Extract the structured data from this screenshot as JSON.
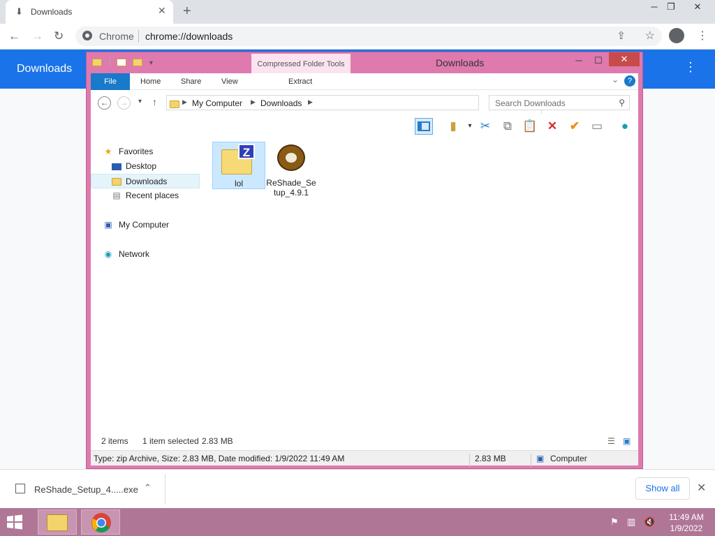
{
  "browser": {
    "tab_title": "Downloads",
    "tab_icon": "download-icon",
    "omnibox_site": "Chrome",
    "omnibox_url": "chrome://downloads"
  },
  "downloads_page": {
    "title": "Downloads"
  },
  "explorer": {
    "window_title": "Downloads",
    "context_tab": "Compressed Folder Tools",
    "ribbon_tabs": [
      "File",
      "Home",
      "Share",
      "View"
    ],
    "context_subtab": "Extract",
    "path": [
      "My Computer",
      "Downloads"
    ],
    "search_placeholder": "Search Downloads",
    "nav": {
      "favorites": "Favorites",
      "desktop": "Desktop",
      "downloads": "Downloads",
      "recent": "Recent places",
      "computer": "My Computer",
      "network": "Network"
    },
    "files": [
      {
        "name": "lol",
        "icon": "zip-folder-icon",
        "selected": true
      },
      {
        "name": "ReShade_Se tup_4.9.1",
        "icon": "reshade-app-icon",
        "selected": false
      }
    ],
    "status": {
      "count": "2 items",
      "selection": "1 item selected",
      "selection_size": "2.83 MB"
    },
    "details": {
      "description": "Type: zip Archive, Size: 2.83 MB, Date modified: 1/9/2022 11:49 AM",
      "size": "2.83 MB",
      "location": "Computer"
    }
  },
  "shelf": {
    "filename": "ReShade_Setup_4.....exe",
    "show_all": "Show all"
  },
  "taskbar": {
    "time": "11:49 AM",
    "date": "1/9/2022"
  },
  "colors": {
    "chrome_blue": "#1a73e8",
    "explorer_frame": "#de7aae",
    "ribbon_file": "#1979ca",
    "taskbar": "#b07696"
  }
}
